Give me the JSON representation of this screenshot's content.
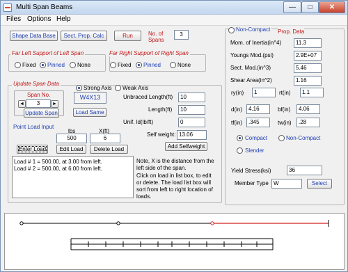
{
  "window": {
    "title": "Multi Span Beams",
    "min": "—",
    "max": "□",
    "close": "✕"
  },
  "menu": {
    "files": "Files",
    "options": "Options",
    "help": "Help"
  },
  "toolbar": {
    "shape_db": "Shape Data Base",
    "sect_calc": "Sect. Prop. Calc",
    "run": "Run",
    "no_spans_label": "No. of Spans",
    "no_spans": "3"
  },
  "supports": {
    "left_title": "Far Left Support of Left Span",
    "right_title": "Far Right Support of Right Span",
    "fixed": "Fixed",
    "pinned": "Pinned",
    "none": "None",
    "left_selected": "Pinned",
    "right_selected": "Pinned"
  },
  "update": {
    "title": "Update Span Data",
    "span_no_label": "Span No.",
    "span_no": "3",
    "update_span": "Update Span",
    "strong_axis": "Strong Axis",
    "weak_axis": "Weak Axis",
    "shape": "W4X13",
    "load_same": "Load Same",
    "unbraced_label": "Unbraced Length(ft)",
    "unbraced": "10",
    "length_label": "Length(ft)",
    "length": "10",
    "unif_label": "Unif. ld(lb/ft)",
    "unif": "0",
    "selfweight_label": "Self weight:",
    "selfweight": "13.06",
    "add_selfweight": "Add Selfweight"
  },
  "point_load": {
    "title": "Point Load Input",
    "lbs_label": "lbs",
    "x_label": "X(ft)",
    "lbs": "500",
    "x": "6",
    "enter": "Enter Load",
    "edit": "Edit Load",
    "delete": "Delete Load",
    "list": [
      "Load # 1 = 500.00, at 3.00 from left.",
      "Load # 2 = 500.00, at 6.00 from left."
    ]
  },
  "notes": {
    "note1": "Note, X is the distance from the left side of the span.",
    "note2": "Click on load in list box, to edit or delete. The load list box will sort from left to right location of loads."
  },
  "props": {
    "noncompact": "Non-Compact",
    "title_tail": "Prop. Data",
    "mom_label": "Mom. of Inertia(in^4)",
    "mom": "11.3",
    "youngs_label": "Youngs Mod.(psi)",
    "youngs": "2.9E+07",
    "sect_label": "Sect. Mod.(in^3)",
    "sect": "5.46",
    "shear_label": "Shear Area(in^2)",
    "shear": "1.16",
    "ry_label": "ry(in)",
    "ry": "1",
    "rt_label": "rt(in)",
    "rt": "1.1",
    "d_label": "d(in)",
    "d": "4.16",
    "bf_label": "bf(in)",
    "bf": "4.06",
    "tf_label": "tf(in)",
    "tf": ".345",
    "tw_label": "tw(in)",
    "tw": ".28",
    "compact": "Compact",
    "noncompact2": "Non-Compact",
    "slender": "Slender",
    "yield_label": "Yield Stress(ksi)",
    "yield": "36",
    "member_label": "Member Type",
    "member": "W",
    "select": "Select"
  },
  "colors": {
    "accent_red": "#c31414",
    "accent_blue": "#1e3fb0",
    "beam_red": "#d42020"
  }
}
